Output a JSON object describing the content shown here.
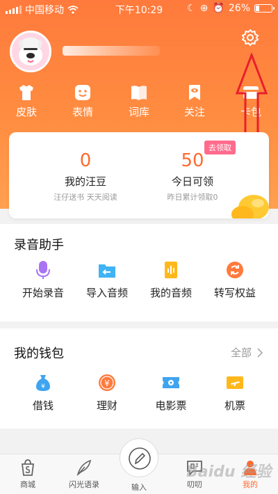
{
  "status_bar": {
    "carrier": "中国移动",
    "time": "下午10:29",
    "battery": "26%",
    "battery_level": 0.26
  },
  "profile": {
    "username": ""
  },
  "quick_links": [
    {
      "label": "皮肤",
      "icon": "shirt-icon"
    },
    {
      "label": "表情",
      "icon": "emoji-icon"
    },
    {
      "label": "词库",
      "icon": "book-icon"
    },
    {
      "label": "关注",
      "icon": "bookmark-eye-icon"
    },
    {
      "label": "卡包",
      "icon": "card-icon"
    }
  ],
  "wallet_card": {
    "beans": {
      "value": "0",
      "label": "我的汪豆",
      "sub": "汪仔送书 天天阅读"
    },
    "today": {
      "value": "50",
      "label": "今日可领",
      "sub": "昨日累计领取0"
    },
    "badge": "去领取"
  },
  "recording": {
    "title": "录音助手",
    "items": [
      {
        "label": "开始录音",
        "icon": "microphone-icon"
      },
      {
        "label": "导入音频",
        "icon": "folder-import-icon"
      },
      {
        "label": "我的音频",
        "icon": "audio-file-icon"
      },
      {
        "label": "转写权益",
        "icon": "transcribe-rights-icon"
      }
    ]
  },
  "wallet": {
    "title": "我的钱包",
    "more": "全部",
    "items": [
      {
        "label": "借钱",
        "icon": "money-bag-icon"
      },
      {
        "label": "理财",
        "icon": "yuan-coin-icon"
      },
      {
        "label": "电影票",
        "icon": "film-ticket-icon"
      },
      {
        "label": "机票",
        "icon": "flight-ticket-icon"
      }
    ]
  },
  "tabbar": {
    "items": [
      {
        "label": "商城",
        "icon": "shop-icon"
      },
      {
        "label": "闪光语录",
        "icon": "feather-icon"
      },
      {
        "label": "输入",
        "icon": "pen-icon"
      },
      {
        "label": "叨叨",
        "icon": "chat-icon"
      },
      {
        "label": "我的",
        "icon": "profile-icon"
      }
    ],
    "active": "我的"
  },
  "colors": {
    "accent": "#ff6a2f",
    "header_start": "#ff7a3c",
    "annotation": "#e8202a"
  },
  "watermark": "Baidu 经验"
}
